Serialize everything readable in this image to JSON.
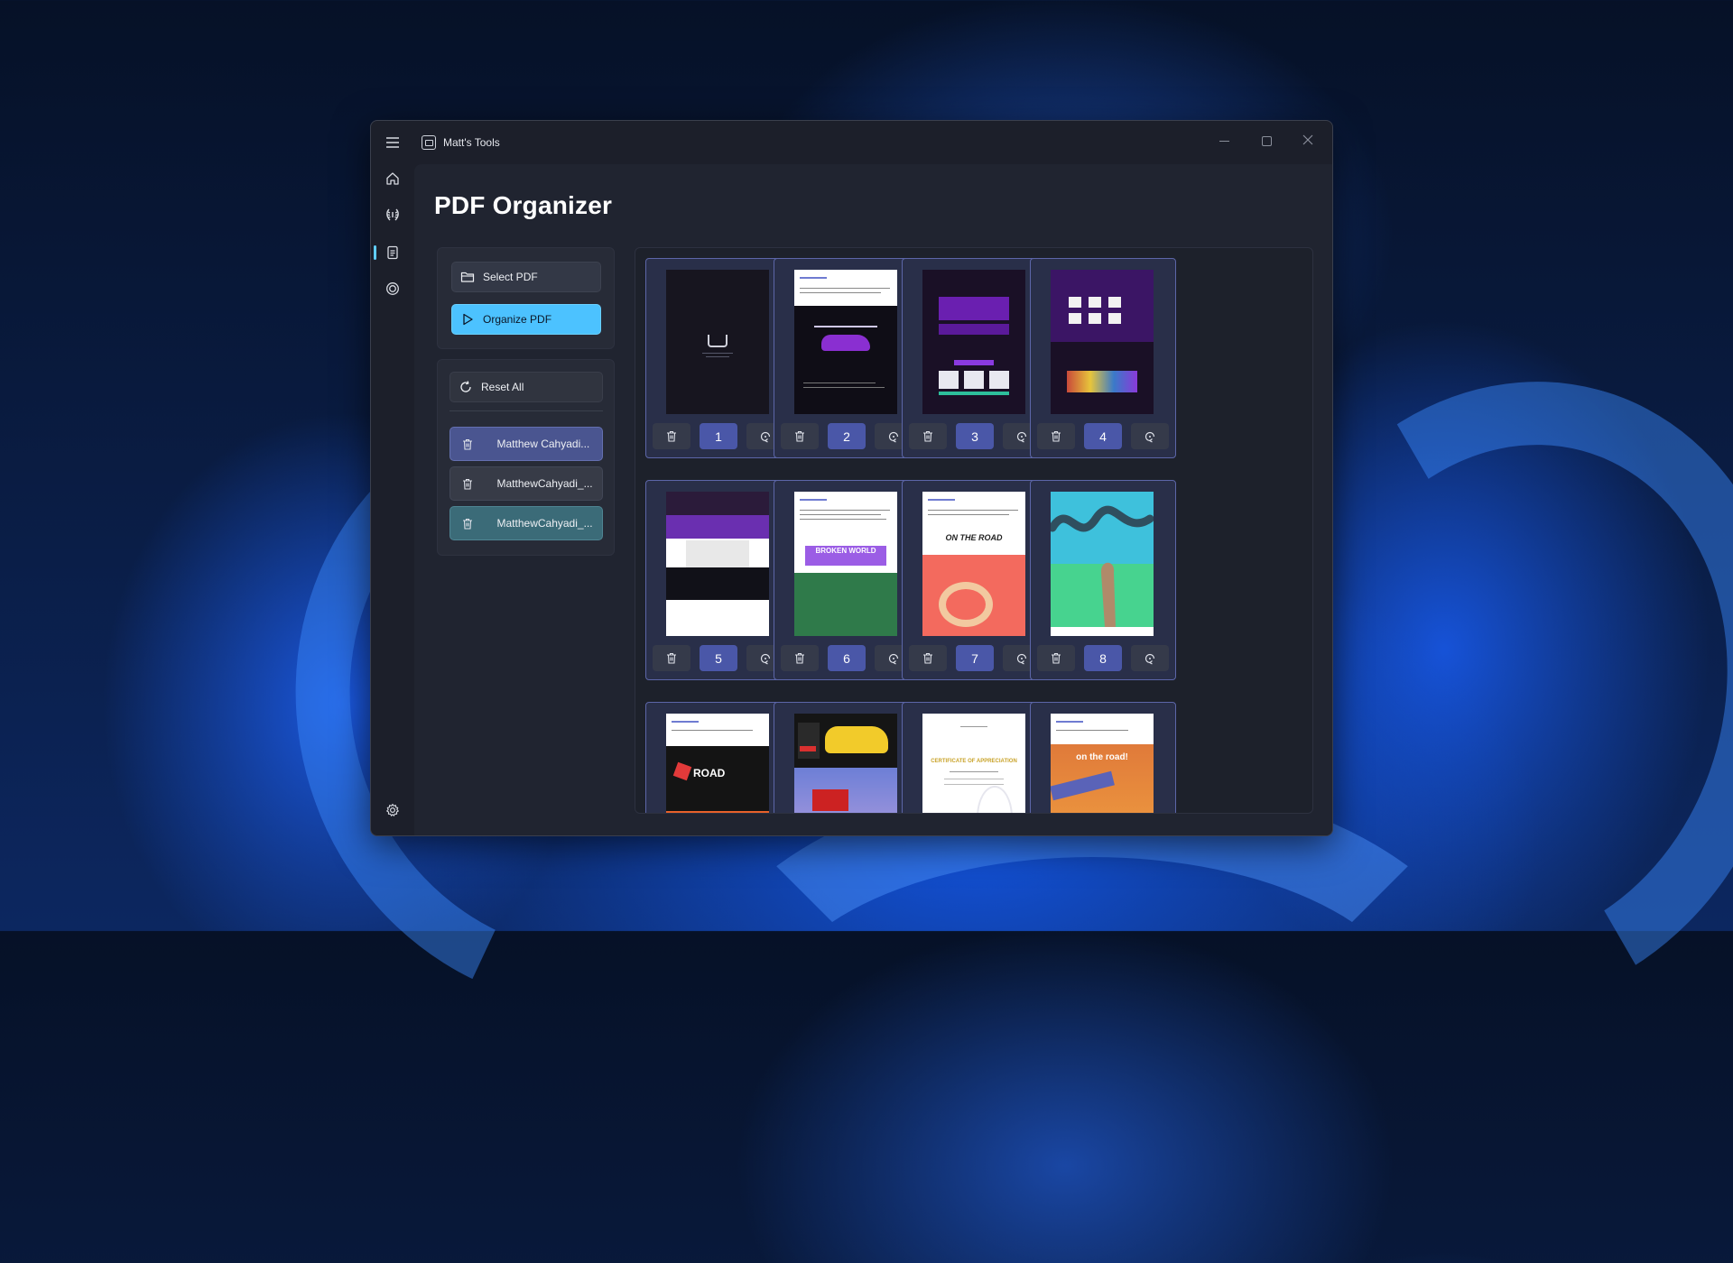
{
  "window": {
    "app_title": "Matt's Tools",
    "controls": [
      "minimize",
      "maximize",
      "close"
    ]
  },
  "nav_rail": {
    "items": [
      {
        "name": "menu-icon"
      },
      {
        "name": "home-icon"
      },
      {
        "name": "laurel-icon"
      },
      {
        "name": "pdf-organizer-icon",
        "selected": true
      },
      {
        "name": "circle-icon"
      },
      {
        "name": "settings-icon"
      }
    ]
  },
  "page": {
    "title": "PDF Organizer"
  },
  "actions": {
    "select_pdf": "Select PDF",
    "organize_pdf": "Organize PDF",
    "reset_all": "Reset All"
  },
  "files": [
    {
      "name": "Matthew Cahyadi...",
      "color": "#4a5590"
    },
    {
      "name": "MatthewCahyadi_...",
      "color": "#373b47"
    },
    {
      "name": "MatthewCahyadi_...",
      "color": "#3b6b78"
    }
  ],
  "pages": [
    {
      "number": "1"
    },
    {
      "number": "2"
    },
    {
      "number": "3"
    },
    {
      "number": "4"
    },
    {
      "number": "5"
    },
    {
      "number": "6"
    },
    {
      "number": "7"
    },
    {
      "number": "8"
    },
    {
      "number": ""
    },
    {
      "number": ""
    },
    {
      "number": ""
    },
    {
      "number": ""
    }
  ],
  "thumb_text": {
    "p7": "ON THE ROAD",
    "p6": "BROKEN WORLD",
    "p9": "ROAD",
    "p11": "CERTIFICATE OF APPRECIATION",
    "p12": "on the road!"
  },
  "colors": {
    "accent": "#4cc2ff",
    "page_number_bg": "#4a57a8",
    "page_card_border": "#5c66a8"
  }
}
